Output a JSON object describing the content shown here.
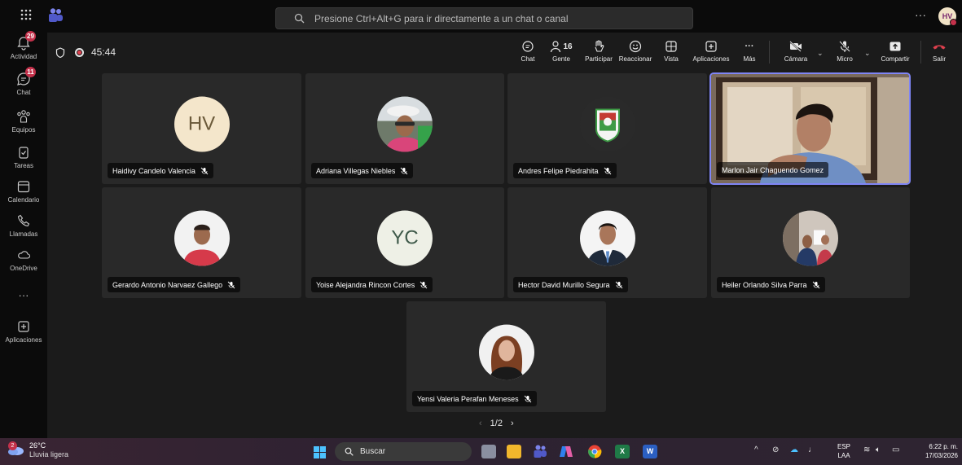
{
  "app": {
    "search_placeholder": "Presione Ctrl+Alt+G para ir directamente a un chat o canal",
    "more": "···",
    "user_initials": "HV"
  },
  "rail": {
    "items": [
      {
        "label": "Actividad",
        "badge": "29"
      },
      {
        "label": "Chat",
        "badge": "11"
      },
      {
        "label": "Equipos"
      },
      {
        "label": "Tareas"
      },
      {
        "label": "Calendario"
      },
      {
        "label": "Llamadas"
      },
      {
        "label": "OneDrive"
      },
      {
        "label": "···"
      },
      {
        "label": "Aplicaciones"
      }
    ]
  },
  "meeting": {
    "elapsed": "45:44",
    "people_count": "16",
    "toolbar": {
      "chat": "Chat",
      "people": "Gente",
      "raise": "Participar",
      "react": "Reaccionar",
      "view": "Vista",
      "apps": "Aplicaciones",
      "more": "Más",
      "camera": "Cámara",
      "mic": "Micro",
      "share": "Compartir",
      "leave": "Salir"
    },
    "participants": [
      {
        "name": "Haidivy Candelo Valencia",
        "initials": "HV"
      },
      {
        "name": "Adriana Villegas Niebles"
      },
      {
        "name": "Andres Felipe Piedrahita"
      },
      {
        "name": "Marlon Jair Chaguendo Gomez",
        "active_speaker": true
      },
      {
        "name": "Gerardo Antonio Narvaez Gallego"
      },
      {
        "name": "Yoise Alejandra Rincon Cortes",
        "initials": "YC"
      },
      {
        "name": "Hector David Murillo Segura"
      },
      {
        "name": "Heiler Orlando Silva Parra"
      },
      {
        "name": "Yensi Valeria Perafan Meneses"
      }
    ],
    "pager": {
      "label": "1/2",
      "prev": "‹",
      "next": "›"
    }
  },
  "taskbar": {
    "weather": {
      "temp": "26°C",
      "desc": "Lluvia ligera",
      "badge": "2"
    },
    "search": "Buscar",
    "lang": {
      "line1": "ESP",
      "line2": "LAA"
    },
    "clock": {
      "time": "6:22 p. m.",
      "date": "17/03/2026"
    }
  },
  "colors": {
    "accent": "#7f85f5",
    "leave": "#e0404e",
    "badge": "#c4314b"
  }
}
